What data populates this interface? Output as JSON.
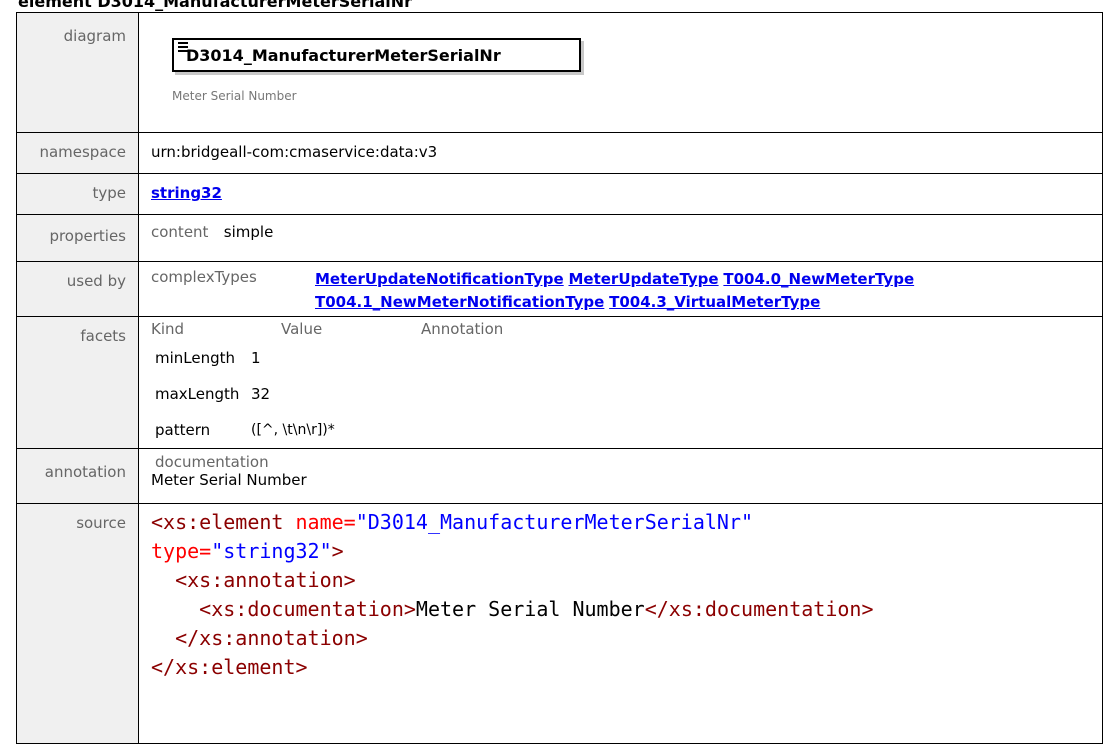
{
  "heading": "element D3014_ManufacturerMeterSerialNr",
  "labels": {
    "diagram": "diagram",
    "namespace": "namespace",
    "type": "type",
    "properties": "properties",
    "used_by": "used by",
    "facets": "facets",
    "annotation": "annotation",
    "source": "source"
  },
  "diagram": {
    "element_name": "D3014_ManufacturerMeterSerialNr",
    "documentation": "Meter Serial Number"
  },
  "namespace": "urn:bridgeall-com:cmaservice:data:v3",
  "type_link": "string32",
  "properties": {
    "key": "content",
    "value": "simple"
  },
  "used_by": {
    "category": "complexTypes",
    "links": [
      "MeterUpdateNotificationType",
      "MeterUpdateType",
      "T004.0_NewMeterType",
      "T004.1_NewMeterNotificationType",
      "T004.3_VirtualMeterType"
    ]
  },
  "facets": {
    "headers": [
      "Kind",
      "Value",
      "Annotation"
    ],
    "rows": [
      {
        "kind": "minLength",
        "value": "1"
      },
      {
        "kind": "maxLength",
        "value": "32"
      },
      {
        "kind": "pattern",
        "value": "([^, \\t\\n\\r])*"
      }
    ]
  },
  "annotation": {
    "label": "documentation",
    "text": "Meter Serial Number"
  },
  "source": {
    "open_tag": "<xs:element",
    "name_attr": " name=",
    "name_val": "\"D3014_ManufacturerMeterSerialNr\"",
    "type_attr": "type=",
    "type_val": "\"string32\"",
    "close_bracket": ">",
    "annotation_open": "<xs:annotation>",
    "doc_open": "<xs:documentation>",
    "doc_text": "Meter Serial Number",
    "doc_close": "</xs:documentation>",
    "annotation_close": "</xs:annotation>",
    "element_close": "</xs:element>"
  }
}
